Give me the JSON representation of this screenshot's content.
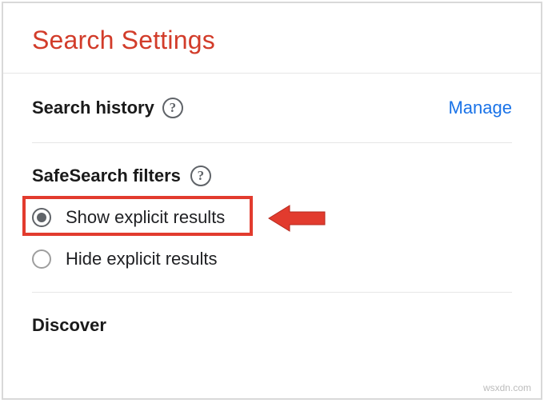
{
  "header": {
    "title": "Search Settings"
  },
  "sections": {
    "searchHistory": {
      "label": "Search history",
      "helpHint": "?",
      "manage": "Manage"
    },
    "safeSearch": {
      "label": "SafeSearch filters",
      "helpHint": "?",
      "options": [
        {
          "label": "Show explicit results",
          "selected": true
        },
        {
          "label": "Hide explicit results",
          "selected": false
        }
      ]
    },
    "discover": {
      "label": "Discover"
    }
  },
  "watermark": "wsxdn.com"
}
